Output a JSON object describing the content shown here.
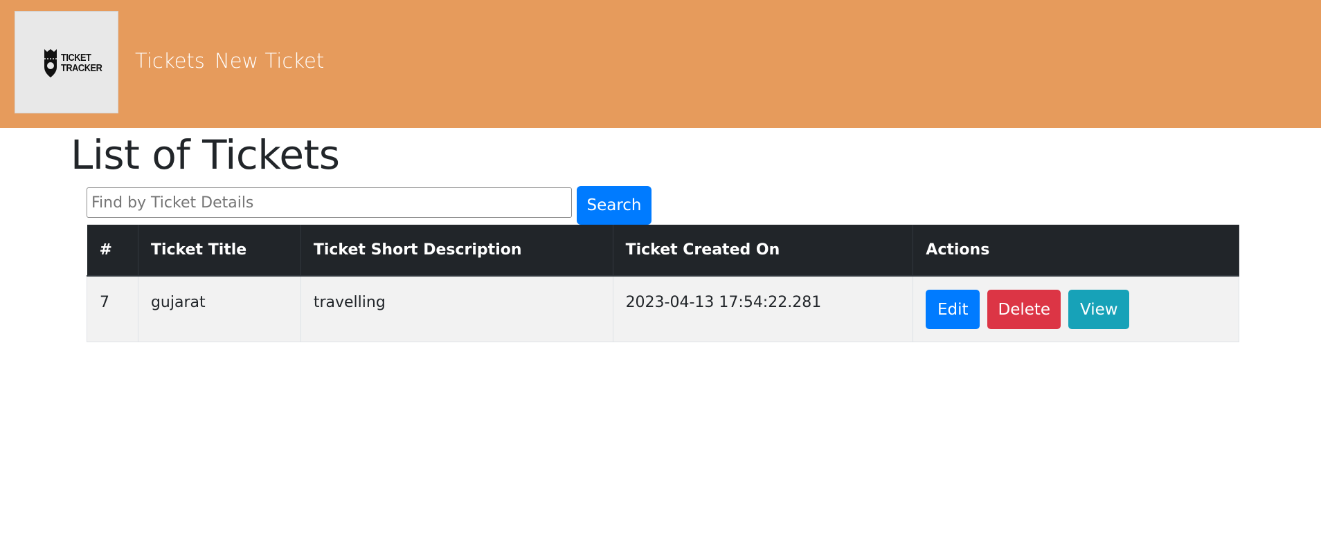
{
  "navbar": {
    "logo_text_line1": "TICKET",
    "logo_text_line2": "TRACKER",
    "links": [
      {
        "label": "Tickets"
      },
      {
        "label": "New Ticket"
      }
    ],
    "background_color": "#e69b5c"
  },
  "main": {
    "title": "List of Tickets",
    "search": {
      "placeholder": "Find by Ticket Details",
      "value": "",
      "button_label": "Search"
    },
    "table": {
      "columns": [
        "#",
        "Ticket Title",
        "Ticket Short Description",
        "Ticket Created On",
        "Actions"
      ],
      "rows": [
        {
          "id": "7",
          "title": "gujarat",
          "description": "travelling",
          "created_on": "2023-04-13 17:54:22.281",
          "actions": {
            "edit_label": "Edit",
            "delete_label": "Delete",
            "view_label": "View"
          }
        }
      ]
    }
  },
  "colors": {
    "primary": "#007bff",
    "danger": "#dc3545",
    "info": "#17a2b8",
    "table_header": "#212529"
  }
}
